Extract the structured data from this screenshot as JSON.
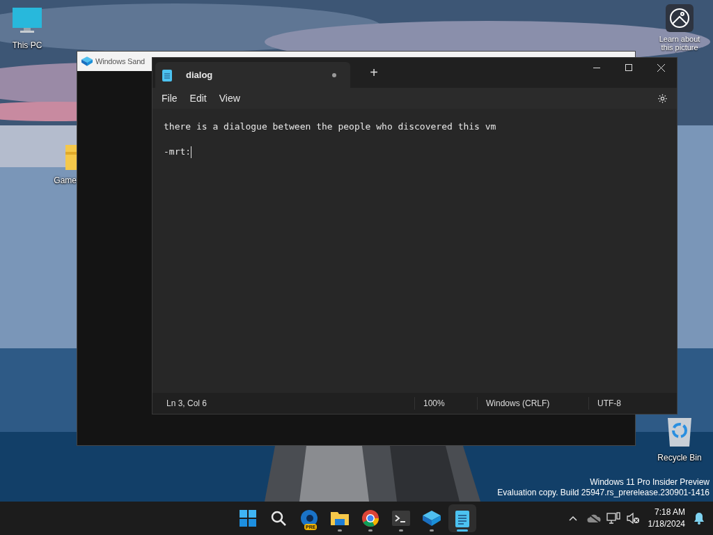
{
  "desktop_icons": [
    {
      "kind": "pc",
      "label": "This PC"
    },
    {
      "kind": "folder",
      "label": "Game"
    },
    {
      "kind": "bin",
      "label": "Recycle Bin"
    }
  ],
  "spotlight": {
    "lines": [
      "Learn about",
      "this picture"
    ]
  },
  "sandbox_window": {
    "title": "Windows Sand"
  },
  "notepad": {
    "tab": {
      "title": "dialog",
      "unsaved": true
    },
    "new_tab": "+",
    "menu": [
      "File",
      "Edit",
      "View"
    ],
    "lines": [
      "there is a dialogue between the people who discovered this vm",
      "-mrt:"
    ],
    "status": [
      "Ln 3, Col 6",
      "100%",
      "Windows (CRLF)",
      "UTF-8"
    ]
  },
  "watermark": [
    "Windows 11 Pro Insider Preview",
    "Evaluation copy. Build 25947.rs_prerelease.230901-1416"
  ],
  "taskbar": {
    "apps": [
      {
        "kind": "start",
        "running": false,
        "selected": false
      },
      {
        "kind": "search",
        "running": false,
        "selected": false
      },
      {
        "kind": "browser",
        "running": false,
        "selected": false
      },
      {
        "kind": "explorer",
        "running": true,
        "selected": false
      },
      {
        "kind": "chrome",
        "running": true,
        "selected": false
      },
      {
        "kind": "terminal",
        "running": true,
        "selected": false
      },
      {
        "kind": "sandbox",
        "running": true,
        "selected": false
      },
      {
        "kind": "notepad",
        "running": true,
        "selected": true
      }
    ],
    "badge": "PRE",
    "clock": {
      "time": "7:18 AM",
      "date": "1/18/2024"
    }
  }
}
